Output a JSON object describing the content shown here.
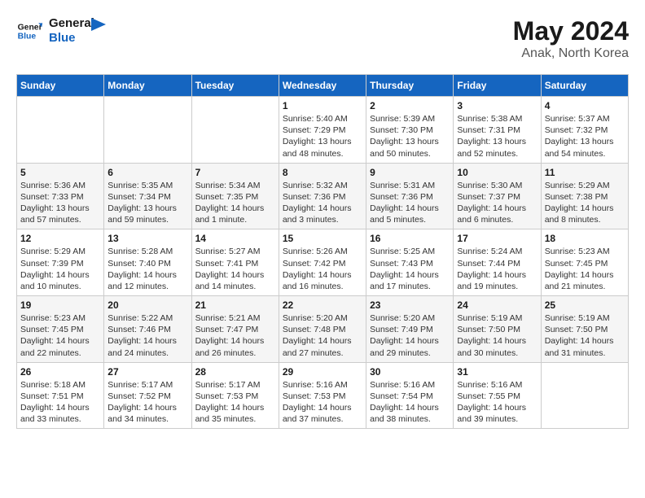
{
  "logo": {
    "line1": "General",
    "line2": "Blue"
  },
  "title": "May 2024",
  "location": "Anak, North Korea",
  "headers": [
    "Sunday",
    "Monday",
    "Tuesday",
    "Wednesday",
    "Thursday",
    "Friday",
    "Saturday"
  ],
  "weeks": [
    [
      null,
      null,
      null,
      {
        "day": "1",
        "sunrise": "5:40 AM",
        "sunset": "7:29 PM",
        "daylight": "13 hours and 48 minutes."
      },
      {
        "day": "2",
        "sunrise": "5:39 AM",
        "sunset": "7:30 PM",
        "daylight": "13 hours and 50 minutes."
      },
      {
        "day": "3",
        "sunrise": "5:38 AM",
        "sunset": "7:31 PM",
        "daylight": "13 hours and 52 minutes."
      },
      {
        "day": "4",
        "sunrise": "5:37 AM",
        "sunset": "7:32 PM",
        "daylight": "13 hours and 54 minutes."
      }
    ],
    [
      {
        "day": "5",
        "sunrise": "5:36 AM",
        "sunset": "7:33 PM",
        "daylight": "13 hours and 57 minutes."
      },
      {
        "day": "6",
        "sunrise": "5:35 AM",
        "sunset": "7:34 PM",
        "daylight": "13 hours and 59 minutes."
      },
      {
        "day": "7",
        "sunrise": "5:34 AM",
        "sunset": "7:35 PM",
        "daylight": "14 hours and 1 minute."
      },
      {
        "day": "8",
        "sunrise": "5:32 AM",
        "sunset": "7:36 PM",
        "daylight": "14 hours and 3 minutes."
      },
      {
        "day": "9",
        "sunrise": "5:31 AM",
        "sunset": "7:36 PM",
        "daylight": "14 hours and 5 minutes."
      },
      {
        "day": "10",
        "sunrise": "5:30 AM",
        "sunset": "7:37 PM",
        "daylight": "14 hours and 6 minutes."
      },
      {
        "day": "11",
        "sunrise": "5:29 AM",
        "sunset": "7:38 PM",
        "daylight": "14 hours and 8 minutes."
      }
    ],
    [
      {
        "day": "12",
        "sunrise": "5:29 AM",
        "sunset": "7:39 PM",
        "daylight": "14 hours and 10 minutes."
      },
      {
        "day": "13",
        "sunrise": "5:28 AM",
        "sunset": "7:40 PM",
        "daylight": "14 hours and 12 minutes."
      },
      {
        "day": "14",
        "sunrise": "5:27 AM",
        "sunset": "7:41 PM",
        "daylight": "14 hours and 14 minutes."
      },
      {
        "day": "15",
        "sunrise": "5:26 AM",
        "sunset": "7:42 PM",
        "daylight": "14 hours and 16 minutes."
      },
      {
        "day": "16",
        "sunrise": "5:25 AM",
        "sunset": "7:43 PM",
        "daylight": "14 hours and 17 minutes."
      },
      {
        "day": "17",
        "sunrise": "5:24 AM",
        "sunset": "7:44 PM",
        "daylight": "14 hours and 19 minutes."
      },
      {
        "day": "18",
        "sunrise": "5:23 AM",
        "sunset": "7:45 PM",
        "daylight": "14 hours and 21 minutes."
      }
    ],
    [
      {
        "day": "19",
        "sunrise": "5:23 AM",
        "sunset": "7:45 PM",
        "daylight": "14 hours and 22 minutes."
      },
      {
        "day": "20",
        "sunrise": "5:22 AM",
        "sunset": "7:46 PM",
        "daylight": "14 hours and 24 minutes."
      },
      {
        "day": "21",
        "sunrise": "5:21 AM",
        "sunset": "7:47 PM",
        "daylight": "14 hours and 26 minutes."
      },
      {
        "day": "22",
        "sunrise": "5:20 AM",
        "sunset": "7:48 PM",
        "daylight": "14 hours and 27 minutes."
      },
      {
        "day": "23",
        "sunrise": "5:20 AM",
        "sunset": "7:49 PM",
        "daylight": "14 hours and 29 minutes."
      },
      {
        "day": "24",
        "sunrise": "5:19 AM",
        "sunset": "7:50 PM",
        "daylight": "14 hours and 30 minutes."
      },
      {
        "day": "25",
        "sunrise": "5:19 AM",
        "sunset": "7:50 PM",
        "daylight": "14 hours and 31 minutes."
      }
    ],
    [
      {
        "day": "26",
        "sunrise": "5:18 AM",
        "sunset": "7:51 PM",
        "daylight": "14 hours and 33 minutes."
      },
      {
        "day": "27",
        "sunrise": "5:17 AM",
        "sunset": "7:52 PM",
        "daylight": "14 hours and 34 minutes."
      },
      {
        "day": "28",
        "sunrise": "5:17 AM",
        "sunset": "7:53 PM",
        "daylight": "14 hours and 35 minutes."
      },
      {
        "day": "29",
        "sunrise": "5:16 AM",
        "sunset": "7:53 PM",
        "daylight": "14 hours and 37 minutes."
      },
      {
        "day": "30",
        "sunrise": "5:16 AM",
        "sunset": "7:54 PM",
        "daylight": "14 hours and 38 minutes."
      },
      {
        "day": "31",
        "sunrise": "5:16 AM",
        "sunset": "7:55 PM",
        "daylight": "14 hours and 39 minutes."
      },
      null
    ]
  ],
  "labels": {
    "sunrise": "Sunrise:",
    "sunset": "Sunset:",
    "daylight": "Daylight:"
  }
}
